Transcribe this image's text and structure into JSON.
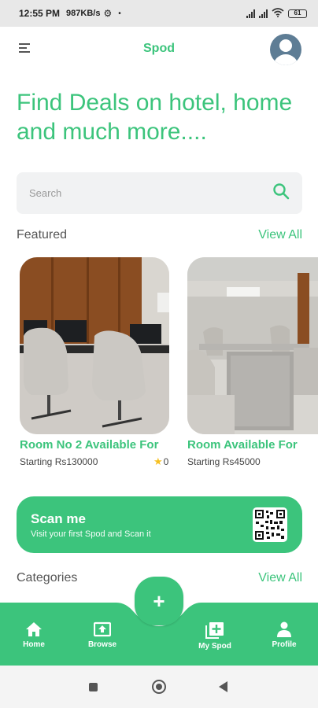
{
  "status_bar": {
    "time": "12:55 PM",
    "network_speed": "987KB/s",
    "battery": "61"
  },
  "header": {
    "menu_icon": "hamburger-icon",
    "title": "Spod",
    "avatar_icon": "user-avatar-icon"
  },
  "headline": "Find Deals on hotel, home and much more....",
  "search": {
    "placeholder": "Search",
    "icon": "search-icon"
  },
  "featured": {
    "title": "Featured",
    "view_all": "View All",
    "items": [
      {
        "title": "Room No 2 Available For",
        "price": "Starting Rs130000",
        "rating": "0"
      },
      {
        "title": "Room Available For",
        "price": "Starting Rs45000"
      }
    ]
  },
  "scan": {
    "title": "Scan me",
    "subtitle": "Visit your first Spod and Scan it",
    "icon": "qr-code-icon"
  },
  "categories": {
    "title": "Categories",
    "view_all": "View All"
  },
  "bottom_nav": {
    "fab_icon": "plus-icon",
    "items": [
      {
        "label": "Home",
        "icon": "home-icon"
      },
      {
        "label": "Browse",
        "icon": "browse-icon"
      },
      {
        "label": "My Spod",
        "icon": "add-square-icon"
      },
      {
        "label": "Profile",
        "icon": "person-icon"
      }
    ]
  },
  "colors": {
    "accent": "#3cc47c",
    "star": "#f6c021"
  }
}
